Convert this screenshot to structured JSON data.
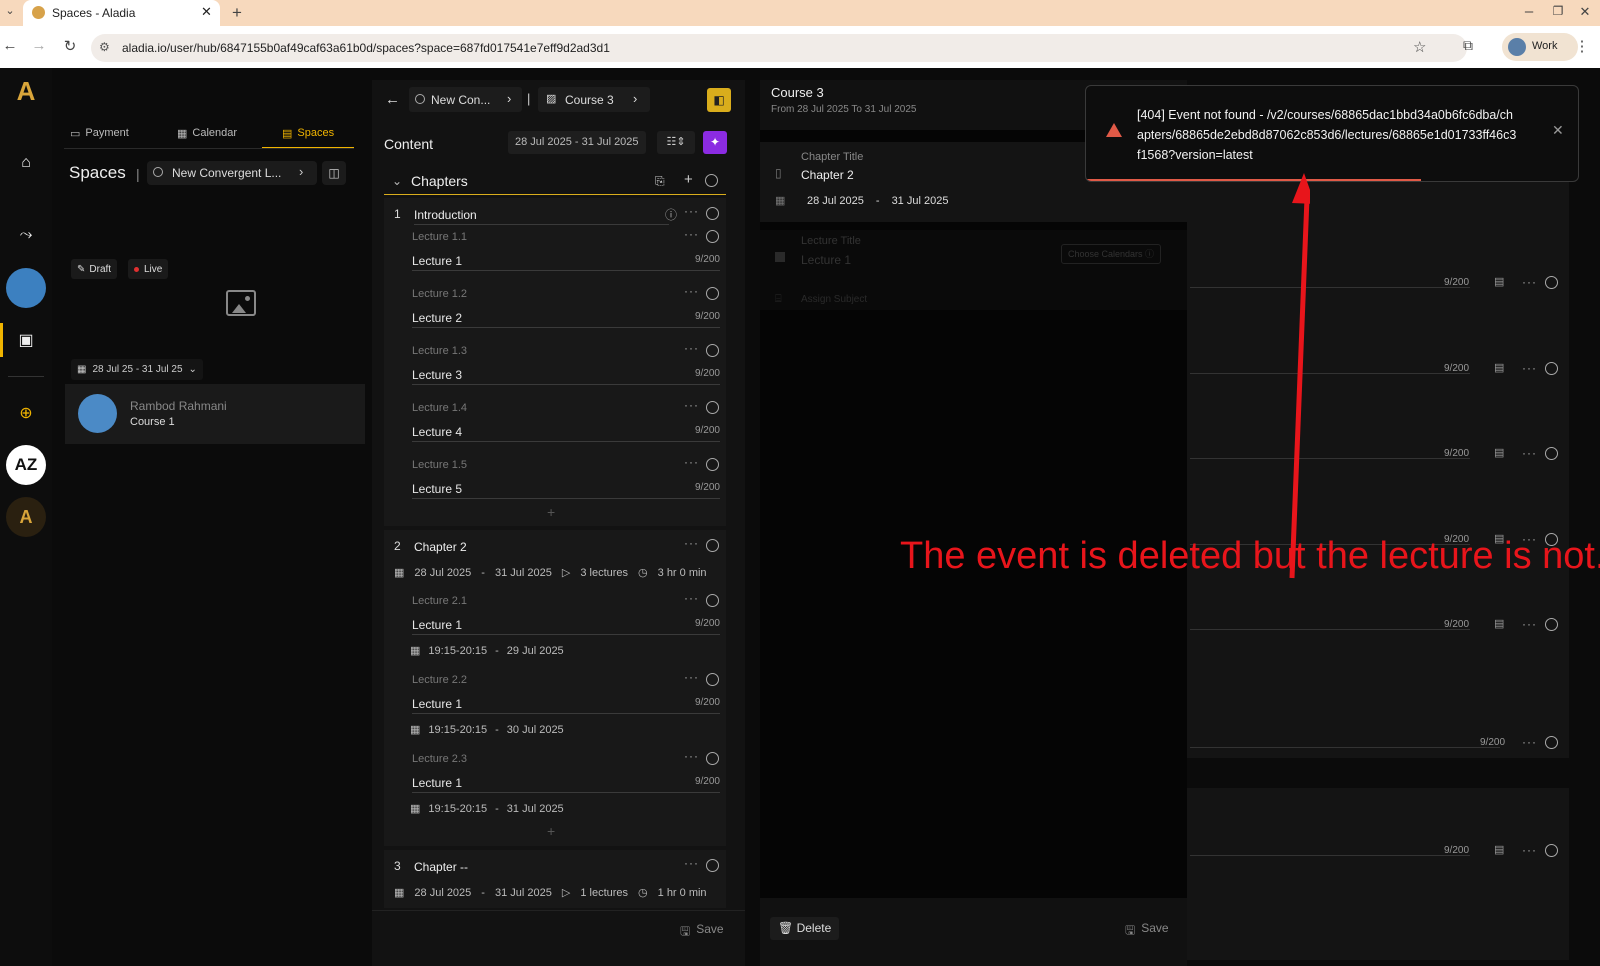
{
  "browser": {
    "tab_title": "Spaces - Aladia",
    "url": "aladia.io/user/hub/6847155b0af49caf63a61b0d/spaces?space=687fd017541e7eff9d2ad3d1",
    "profile_label": "Work"
  },
  "nav": {
    "tabs": [
      {
        "label": "Payment"
      },
      {
        "label": "Calendar"
      },
      {
        "label": "Spaces"
      }
    ]
  },
  "left_panel": {
    "title": "Spaces",
    "space_selector": "New Convergent L...",
    "draft_label": "Draft",
    "live_label": "Live",
    "date_range": "28 Jul 25 - 31 Jul 25",
    "member": {
      "name": "Rambod Rahmani",
      "course": "Course 1"
    }
  },
  "content_panel": {
    "breadcrumb_space": "New Con...",
    "breadcrumb_course": "Course 3",
    "title": "Content",
    "date_range": "28 Jul 2025 - 31 Jul 2025",
    "chapters_label": "Chapters",
    "save_label": "Save",
    "chapters": [
      {
        "number": "1",
        "title": "Introduction",
        "lectures": [
          {
            "num": "Lecture 1.1",
            "name": "Lecture 1",
            "count": "9/200"
          },
          {
            "num": "Lecture 1.2",
            "name": "Lecture 2",
            "count": "9/200"
          },
          {
            "num": "Lecture 1.3",
            "name": "Lecture 3",
            "count": "9/200"
          },
          {
            "num": "Lecture 1.4",
            "name": "Lecture 4",
            "count": "9/200"
          },
          {
            "num": "Lecture 1.5",
            "name": "Lecture 5",
            "count": "9/200"
          }
        ]
      },
      {
        "number": "2",
        "title": "Chapter 2",
        "start": "28 Jul 2025",
        "sep": "-",
        "end": "31 Jul 2025",
        "lectures_count": "3 lectures",
        "duration": "3 hr 0 min",
        "lectures": [
          {
            "num": "Lecture 2.1",
            "name": "Lecture 1",
            "count": "9/200",
            "time": "19:15-20:15",
            "sep": "-",
            "date": "29 Jul 2025"
          },
          {
            "num": "Lecture 2.2",
            "name": "Lecture 1",
            "count": "9/200",
            "time": "19:15-20:15",
            "sep": "-",
            "date": "30 Jul 2025"
          },
          {
            "num": "Lecture 2.3",
            "name": "Lecture 1",
            "count": "9/200",
            "time": "19:15-20:15",
            "sep": "-",
            "date": "31 Jul 2025"
          }
        ]
      },
      {
        "number": "3",
        "title": "Chapter --",
        "start": "28 Jul 2025",
        "sep": "-",
        "end": "31 Jul 2025",
        "lectures_count": "1 lectures",
        "duration": "1 hr 0 min"
      }
    ]
  },
  "editor_panel": {
    "course_title": "Course 3",
    "course_dates": "From 28 Jul 2025 To 31 Jul 2025",
    "chapter_title_label": "Chapter Title",
    "chapter_title_value": "Chapter 2",
    "chapter_start": "28 Jul 2025",
    "chapter_sep": "-",
    "chapter_end": "31 Jul 2025",
    "lecture_title_label": "Lecture Title",
    "lecture_title_value": "Lecture 1",
    "choose_calendars": "Choose Calendars",
    "assign_subject": "Assign Subject",
    "delete_label": "Delete",
    "save_label": "Save"
  },
  "background_rows": [
    {
      "count": "9/200"
    },
    {
      "count": "9/200"
    },
    {
      "count": "9/200"
    },
    {
      "count": "9/200"
    },
    {
      "count": "9/200"
    },
    {
      "count": "9/200"
    },
    {
      "count": "9/200"
    }
  ],
  "toast": {
    "text": "[404] Event not found - /v2/courses/68865dac1bbd34a0b6fc6dba/chapters/68865de2ebd8d87062c853d6/lectures/68865e1d01733ff46c3f1568?version=latest",
    "progress": 0.68,
    "color": "#e05a47"
  },
  "annotation": {
    "text": "The event is deleted but the lecture is not.",
    "color": "#e8151b"
  },
  "colors": {
    "accent": "#f0b400",
    "magic": "#8b2be2"
  }
}
